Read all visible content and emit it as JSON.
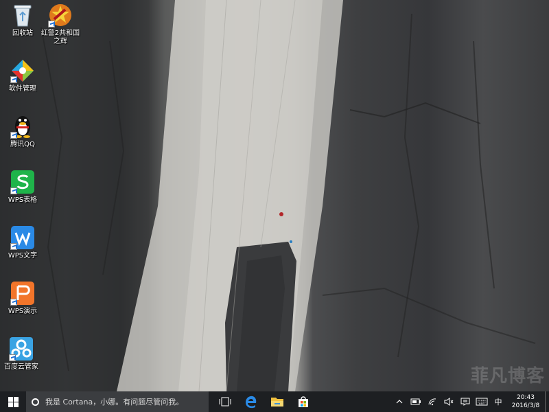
{
  "desktop": {
    "icons": [
      {
        "label": "回收站",
        "icon": "recycle-bin-icon",
        "shortcut": false
      },
      {
        "label": "红警2共和国之辉",
        "icon": "red-alert-game-icon",
        "shortcut": true
      },
      {
        "label": "软件管理",
        "icon": "software-manager-icon",
        "shortcut": true
      },
      {
        "label": "腾讯QQ",
        "icon": "qq-penguin-icon",
        "shortcut": true
      },
      {
        "label": "WPS表格",
        "icon": "wps-spreadsheet-icon",
        "shortcut": true
      },
      {
        "label": "WPS文字",
        "icon": "wps-writer-icon",
        "shortcut": true
      },
      {
        "label": "WPS演示",
        "icon": "wps-presentation-icon",
        "shortcut": true
      },
      {
        "label": "百度云管家",
        "icon": "baidu-cloud-icon",
        "shortcut": true
      }
    ],
    "watermark": "菲凡博客"
  },
  "taskbar": {
    "start_icon": "windows-logo-icon",
    "search_text": "我是 Cortana，小娜。有问题尽管问我。",
    "task_view_icon": "task-view-icon",
    "pinned": [
      {
        "name": "edge-icon"
      },
      {
        "name": "file-explorer-icon"
      },
      {
        "name": "store-icon"
      }
    ],
    "tray": {
      "ime": "中",
      "time": "20:43",
      "date": "2016/3/8"
    }
  },
  "colors": {
    "taskbar_bg": "#1d1f22",
    "search_bg": "#3b3d40",
    "accent_blue": "#1f6fd1"
  }
}
